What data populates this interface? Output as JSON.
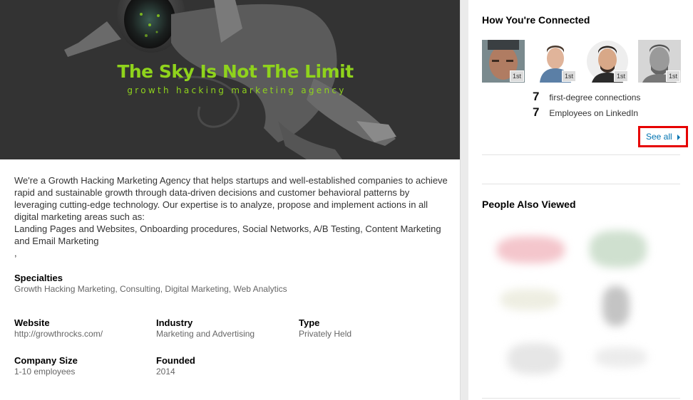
{
  "banner": {
    "title": "The Sky Is Not The Limit",
    "tagline": "growth hacking marketing agency"
  },
  "about": {
    "paragraph": "We're a Growth Hacking Marketing Agency that helps startups and well-established companies to achieve rapid and sustainable growth through data-driven decisions and customer behavioral patterns by leveraging cutting-edge technology. Our expertise is to analyze, propose and implement actions in all digital marketing areas such as:",
    "areas": "Landing Pages and Websites, Onboarding procedures, Social Networks, A/B Testing, Content Marketing and Email Marketing",
    "trailing": ","
  },
  "specialties": {
    "label": "Specialties",
    "value": "Growth Hacking Marketing, Consulting, Digital Marketing, Web Analytics"
  },
  "details": {
    "website": {
      "label": "Website",
      "value": "http://growthrocks.com/"
    },
    "industry": {
      "label": "Industry",
      "value": "Marketing and Advertising"
    },
    "type": {
      "label": "Type",
      "value": "Privately Held"
    },
    "company_size": {
      "label": "Company Size",
      "value": "1-10 employees"
    },
    "founded": {
      "label": "Founded",
      "value": "2014"
    }
  },
  "connections": {
    "title": "How You're Connected",
    "avatars": [
      {
        "badge": "1st"
      },
      {
        "badge": "1st"
      },
      {
        "badge": "1st"
      },
      {
        "badge": "1st"
      }
    ],
    "first_degree_count": "7",
    "first_degree_label": "first-degree connections",
    "employees_count": "7",
    "employees_label": "Employees on LinkedIn",
    "see_all_label": "See all"
  },
  "people_also_viewed": {
    "title": "People Also Viewed"
  },
  "colors": {
    "accent_green": "#8fd31c",
    "link_blue": "#0073b1",
    "highlight_red": "#e60000"
  }
}
